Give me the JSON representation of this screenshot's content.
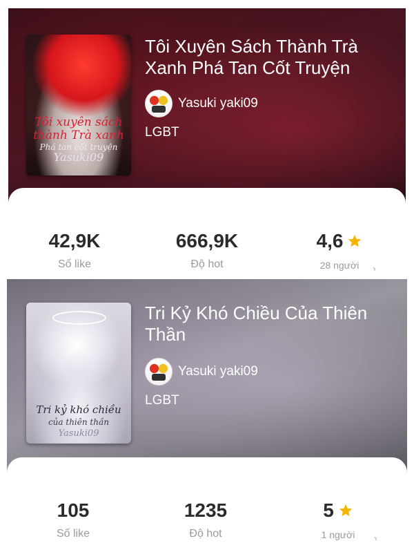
{
  "books": [
    {
      "title": "Tôi Xuyên Sách Thành Trà Xanh Phá Tan Cốt Truyện",
      "author": "Yasuki yaki09",
      "genre": "LGBT",
      "cover_text": {
        "line1": "Tôi xuyên sách thành Trà xanh",
        "line2": "Phá tan cốt truyện",
        "line3": "Yasuki09"
      },
      "stats": {
        "likes": "42,9K",
        "likes_label": "Số like",
        "hot": "666,9K",
        "hot_label": "Độ hot",
        "rating": "4,6",
        "rating_label": "28 người"
      }
    },
    {
      "title": "Tri Kỷ Khó Chiều Của Thiên Thần",
      "author": "Yasuki yaki09",
      "genre": "LGBT",
      "cover_text": {
        "line1": "Tri kỷ khó chiều",
        "line2": "của thiên thần",
        "line3": "Yasuki09"
      },
      "stats": {
        "likes": "105",
        "likes_label": "Số like",
        "hot": "1235",
        "hot_label": "Độ hot",
        "rating": "5",
        "rating_label": "1 người"
      }
    }
  ],
  "colors": {
    "star": "#f5b400",
    "value_text": "#2b2b2b",
    "label_text": "#9a9a9a"
  },
  "icons": {
    "rating": "star-icon",
    "more": "chevron-icon"
  }
}
